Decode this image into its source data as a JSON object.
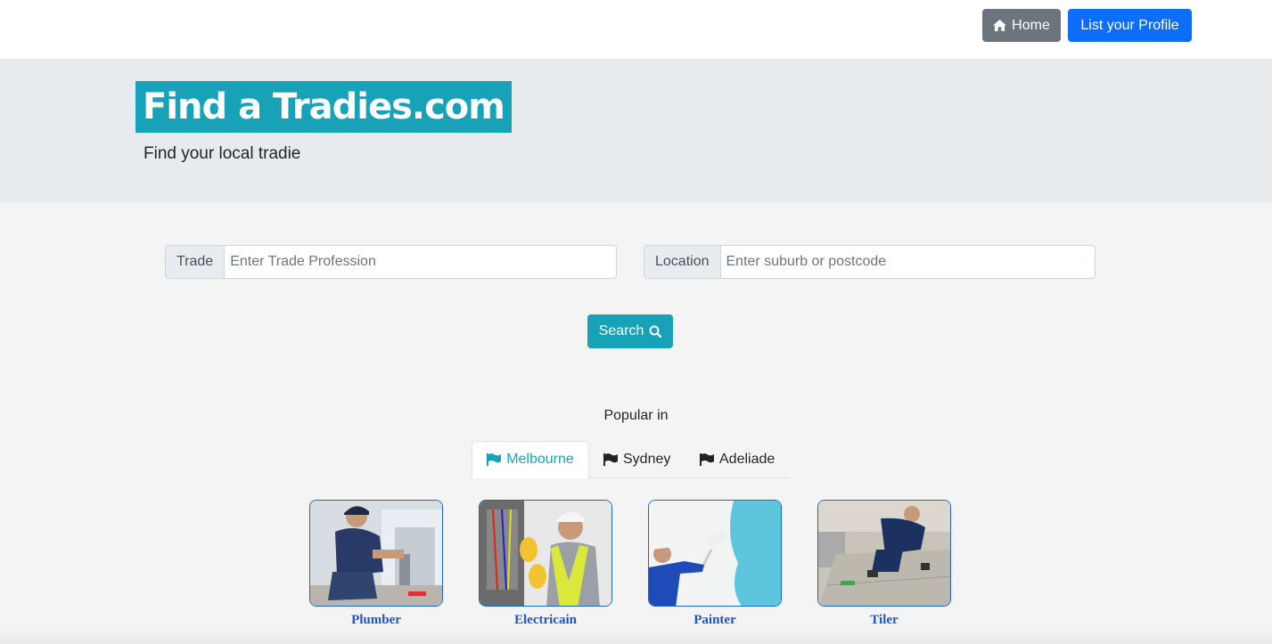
{
  "header": {
    "home_label": "Home",
    "profile_label": "List your Profile"
  },
  "hero": {
    "brand": "Find a Tradies.com",
    "tagline": "Find your local tradie"
  },
  "search": {
    "trade_label": "Trade",
    "trade_placeholder": "Enter Trade Profession",
    "location_label": "Location",
    "location_placeholder": "Enter suburb or postcode",
    "button_label": "Search"
  },
  "popular": {
    "heading": "Popular in",
    "tabs": [
      {
        "label": "Melbourne",
        "active": true
      },
      {
        "label": "Sydney",
        "active": false
      },
      {
        "label": "Adeliade",
        "active": false
      }
    ],
    "trades": [
      {
        "label": "Plumber",
        "icon": "plumber-photo"
      },
      {
        "label": "Electricain",
        "icon": "electrician-photo"
      },
      {
        "label": "Painter",
        "icon": "painter-photo"
      },
      {
        "label": "Tiler",
        "icon": "tiler-photo"
      }
    ]
  },
  "colors": {
    "accent": "#17a2b8",
    "primary": "#0d6efd",
    "secondary": "#6c757d",
    "link": "#1a55d6"
  }
}
